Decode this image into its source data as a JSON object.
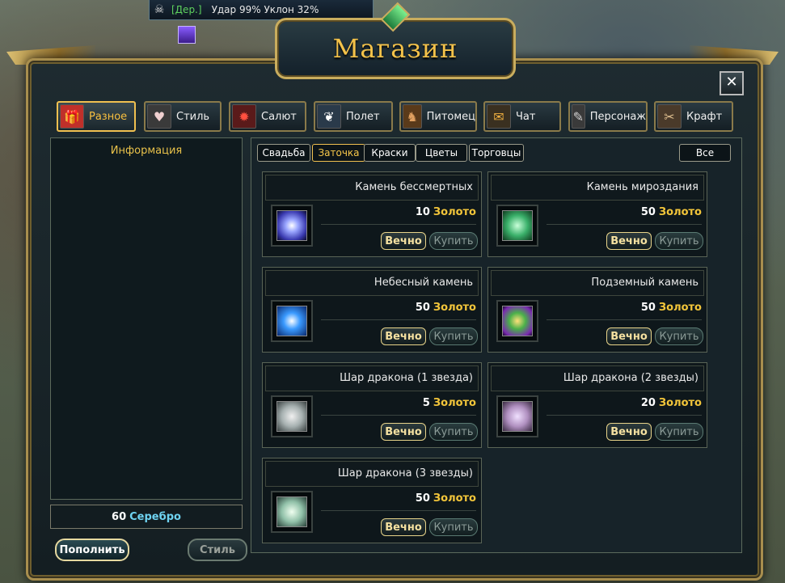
{
  "hud": {
    "rank": "[Дер.]",
    "stats": "Удар 99% Уклон 32%"
  },
  "window": {
    "title": "Магазин"
  },
  "tabs": [
    {
      "label": "Разное",
      "icon": "gift-icon",
      "active": true
    },
    {
      "label": "Стиль",
      "icon": "style-icon",
      "active": false
    },
    {
      "label": "Салют",
      "icon": "firework-icon",
      "active": false
    },
    {
      "label": "Полет",
      "icon": "wing-icon",
      "active": false
    },
    {
      "label": "Питомец",
      "icon": "pet-icon",
      "active": false
    },
    {
      "label": "Чат",
      "icon": "chat-icon",
      "active": false
    },
    {
      "label": "Персонаж",
      "icon": "character-icon",
      "active": false
    },
    {
      "label": "Крафт",
      "icon": "craft-icon",
      "active": false
    }
  ],
  "info": {
    "heading": "Информация",
    "balance_value": "60",
    "balance_unit": "Серебро",
    "refill_label": "Пополнить",
    "style_label": "Стиль"
  },
  "subtabs": [
    "Свадьба",
    "Заточка",
    "Краски",
    "Цветы",
    "Торговцы"
  ],
  "subtab_active": "Заточка",
  "all_label": "Все",
  "items": [
    {
      "name": "Камень бессмертных",
      "price": "10",
      "unit": "Золото",
      "forever": "Вечно",
      "buy": "Купить",
      "icon": "immortal-stone-icon"
    },
    {
      "name": "Камень мироздания",
      "price": "50",
      "unit": "Золото",
      "forever": "Вечно",
      "buy": "Купить",
      "icon": "creation-stone-icon"
    },
    {
      "name": "Небесный камень",
      "price": "50",
      "unit": "Золото",
      "forever": "Вечно",
      "buy": "Купить",
      "icon": "heavenly-stone-icon"
    },
    {
      "name": "Подземный камень",
      "price": "50",
      "unit": "Золото",
      "forever": "Вечно",
      "buy": "Купить",
      "icon": "underground-stone-icon"
    },
    {
      "name": "Шар дракона (1 звезда)",
      "price": "5",
      "unit": "Золото",
      "forever": "Вечно",
      "buy": "Купить",
      "icon": "dragon-ball-1-icon"
    },
    {
      "name": "Шар дракона (2 звезды)",
      "price": "20",
      "unit": "Золото",
      "forever": "Вечно",
      "buy": "Купить",
      "icon": "dragon-ball-2-icon"
    },
    {
      "name": "Шар дракона (3 звезды)",
      "price": "50",
      "unit": "Золото",
      "forever": "Вечно",
      "buy": "Купить",
      "icon": "dragon-ball-3-icon"
    }
  ]
}
